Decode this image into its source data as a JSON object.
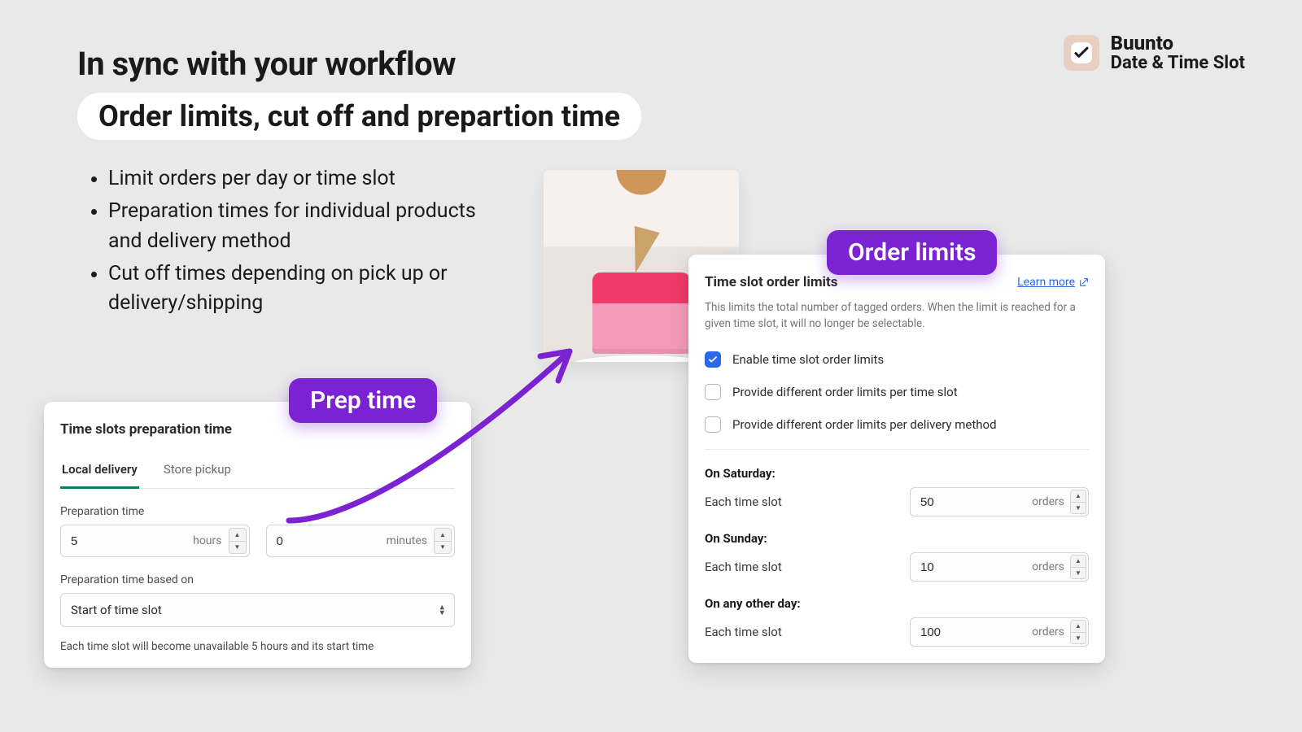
{
  "brand": {
    "name": "Buunto",
    "sub": "Date & Time Slot"
  },
  "headline": "In sync with your workflow",
  "subtitle": "Order limits, cut off and prepartion time",
  "bullets": [
    "Limit orders per day or time slot",
    "Preparation times for individual products and delivery method",
    "Cut off times depending on pick up or delivery/shipping"
  ],
  "labels": {
    "prep": "Prep time",
    "limits": "Order limits"
  },
  "prep": {
    "title": "Time slots preparation time",
    "tabs": {
      "local": "Local delivery",
      "pickup": "Store pickup"
    },
    "field_prep": "Preparation time",
    "hours_value": "5",
    "hours_unit": "hours",
    "minutes_value": "0",
    "minutes_unit": "minutes",
    "field_based": "Preparation time based on",
    "based_value": "Start of time slot",
    "help": "Each time slot will become unavailable 5 hours and its start time"
  },
  "limits": {
    "title": "Time slot order limits",
    "learn": "Learn more",
    "sub": "This limits the total number of tagged orders. When the limit is reached for a given time slot, it will no longer be selectable.",
    "chk_enable": "Enable time slot order limits",
    "chk_per_slot": "Provide different order limits per time slot",
    "chk_per_method": "Provide different order limits per delivery method",
    "each_label": "Each time slot",
    "unit": "orders",
    "groups": [
      {
        "day": "On Saturday:",
        "value": "50"
      },
      {
        "day": "On Sunday:",
        "value": "10"
      },
      {
        "day": "On any other day:",
        "value": "100"
      }
    ]
  }
}
